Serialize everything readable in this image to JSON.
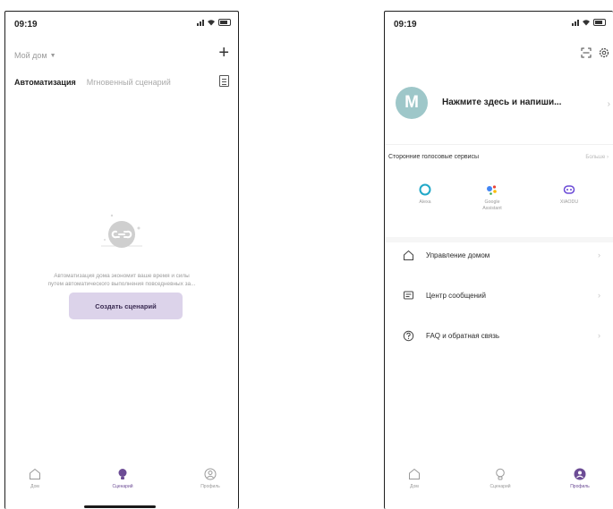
{
  "left_screen": {
    "status_time": "09:19",
    "home_selector": "Мой дом",
    "tabs": {
      "automation": "Автоматизация",
      "instant": "Мгновенный сценарий"
    },
    "empty_text_line1": "Автоматизация дома экономит ваше время и силы",
    "empty_text_line2": "путем автоматического выполнения повседневных за...",
    "create_button": "Создать сценарий",
    "tabbar": {
      "home": "Дом",
      "scenes": "Сценарий",
      "profile": "Профиль"
    }
  },
  "right_screen": {
    "status_time": "09:19",
    "avatar_letter": "M",
    "profile_name": "Нажмите здесь и напиши...",
    "voice_section_title": "Сторонние голосовые сервисы",
    "more_link": "Больше",
    "voice_services": [
      {
        "label": "Alexa",
        "color": "#20a8c8"
      },
      {
        "label": "Google\nAssistant",
        "color": "#4285f4"
      },
      {
        "label": "XIAODU",
        "color": "#6a4ad6"
      }
    ],
    "menu": [
      {
        "label": "Управление домом",
        "icon": "house-icon"
      },
      {
        "label": "Центр сообщений",
        "icon": "message-icon"
      },
      {
        "label": "FAQ и обратная связь",
        "icon": "help-icon"
      }
    ],
    "tabbar": {
      "home": "Дом",
      "scenes": "Сценарий",
      "profile": "Профиль"
    }
  },
  "colors": {
    "accent": "#6c4c95",
    "create_button_bg": "#dcd3ea",
    "avatar_bg": "#9ec7c9"
  }
}
